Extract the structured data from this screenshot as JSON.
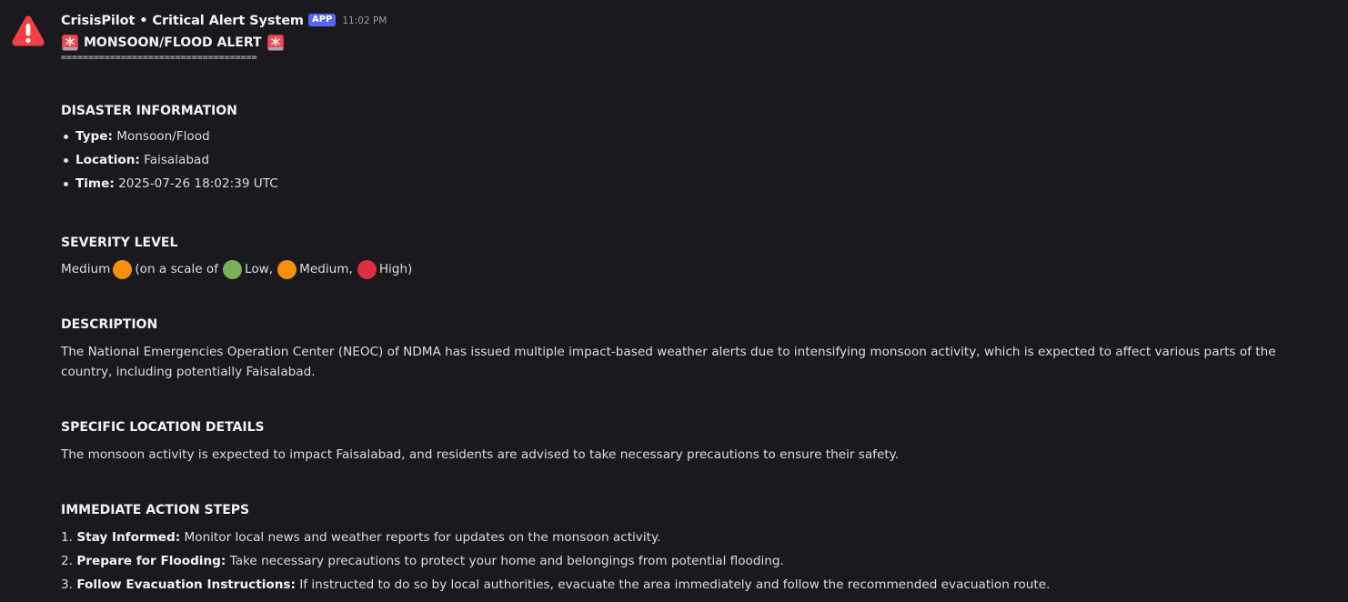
{
  "message": {
    "author": "CrisisPilot • Critical Alert System",
    "badge": "APP",
    "time": "11:02 PM",
    "avatar_icon": "warning-icon",
    "title": "MONSOON/FLOOD ALERT",
    "title_icon": "rotating-light-icon",
    "divider": "===================================="
  },
  "sections": {
    "disaster": {
      "heading": "DISASTER INFORMATION",
      "items": [
        {
          "label": "Type:",
          "value": "Monsoon/Flood"
        },
        {
          "label": "Location:",
          "value": "Faisalabad"
        },
        {
          "label": "Time:",
          "value": "2025-07-26 18:02:39 UTC"
        }
      ]
    },
    "severity": {
      "heading": "SEVERITY LEVEL",
      "level": "Medium",
      "scale_prefix": "(on a scale of",
      "low": "Low,",
      "medium": "Medium,",
      "high": "High)",
      "colors": {
        "low": "#78b159",
        "medium": "#f4900c",
        "high": "#dd2e44"
      }
    },
    "description": {
      "heading": "DESCRIPTION",
      "text": "The National Emergencies Operation Center (NEOC) of NDMA has issued multiple impact-based weather alerts due to intensifying monsoon activity, which is expected to affect various parts of the country, including potentially Faisalabad."
    },
    "location_details": {
      "heading": "SPECIFIC LOCATION DETAILS",
      "text": "The monsoon activity is expected to impact Faisalabad, and residents are advised to take necessary precautions to ensure their safety."
    },
    "actions": {
      "heading": "IMMEDIATE ACTION STEPS",
      "steps": [
        {
          "num": "1.",
          "label": "Stay Informed:",
          "text": "Monitor local news and weather reports for updates on the monsoon activity."
        },
        {
          "num": "2.",
          "label": "Prepare for Flooding:",
          "text": "Take necessary precautions to protect your home and belongings from potential flooding."
        },
        {
          "num": "3.",
          "label": "Follow Evacuation Instructions:",
          "text": "If instructed to do so by local authorities, evacuate the area immediately and follow the recommended evacuation route."
        }
      ]
    }
  },
  "colors": {
    "background": "#1a1a1e",
    "badge": "#5865f2",
    "avatar": "#f23f43"
  }
}
